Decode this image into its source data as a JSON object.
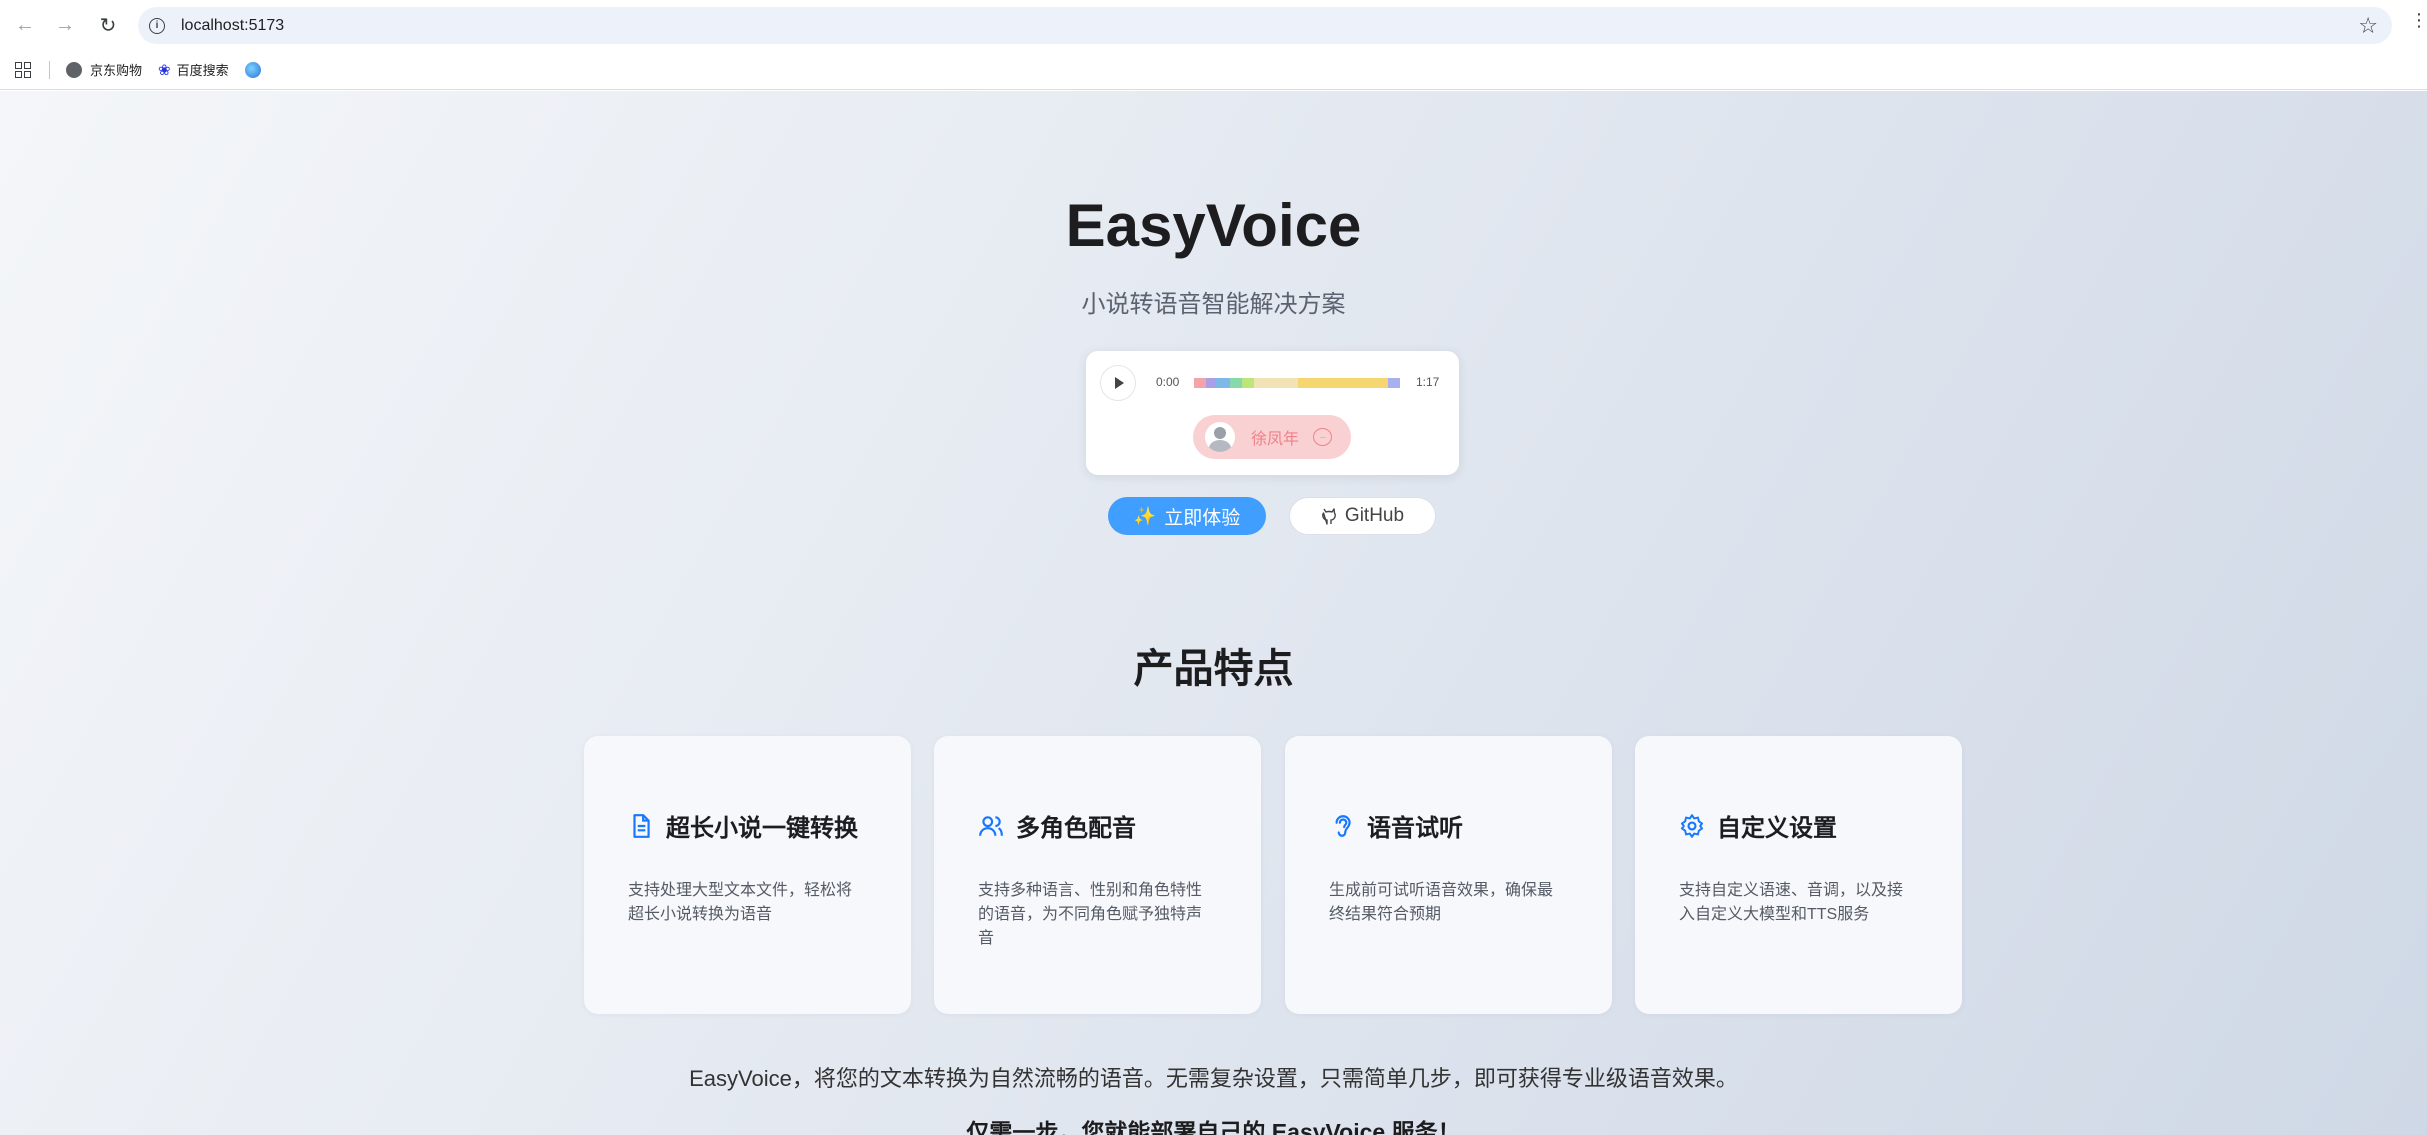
{
  "browser": {
    "url": "localhost:5173",
    "bookmarks": [
      "京东购物",
      "百度搜索"
    ]
  },
  "hero": {
    "title": "EasyVoice",
    "subtitle": "小说转语音智能解决方案"
  },
  "player": {
    "current_time": "0:00",
    "duration": "1:17",
    "progress_colors": [
      "#f4a3a8",
      "#a9a0e8",
      "#7fb7e8",
      "#86d9a9",
      "#bde67a",
      "#f2e3b6",
      "#f5d670",
      "#a8b0f0"
    ],
    "speaker_name": "徐凤年"
  },
  "actions": {
    "try_label": "立即体验",
    "github_label": "GitHub"
  },
  "features": {
    "title": "产品特点",
    "items": [
      {
        "icon": "document-icon",
        "title": "超长小说一键转换",
        "desc": "支持处理大型文本文件，轻松将超长小说转换为语音"
      },
      {
        "icon": "users-icon",
        "title": "多角色配音",
        "desc": "支持多种语言、性别和角色特性的语音，为不同角色赋予独特声音"
      },
      {
        "icon": "ear-icon",
        "title": "语音试听",
        "desc": "生成前可试听语音效果，确保最终结果符合预期"
      },
      {
        "icon": "gear-icon",
        "title": "自定义设置",
        "desc": "支持自定义语速、音调，以及接入自定义大模型和TTS服务"
      }
    ]
  },
  "footer": {
    "tagline": "EasyVoice，将您的文本转换为自然流畅的语音。无需复杂设置，只需简单几步，即可获得专业级语音效果。",
    "deploy": "仅需一步，您就能部署自己的 EasyVoice 服务！"
  },
  "colors": {
    "accent": "#409eff",
    "icon_blue": "#1677ff",
    "speaker_pill": "#fad1d3"
  }
}
